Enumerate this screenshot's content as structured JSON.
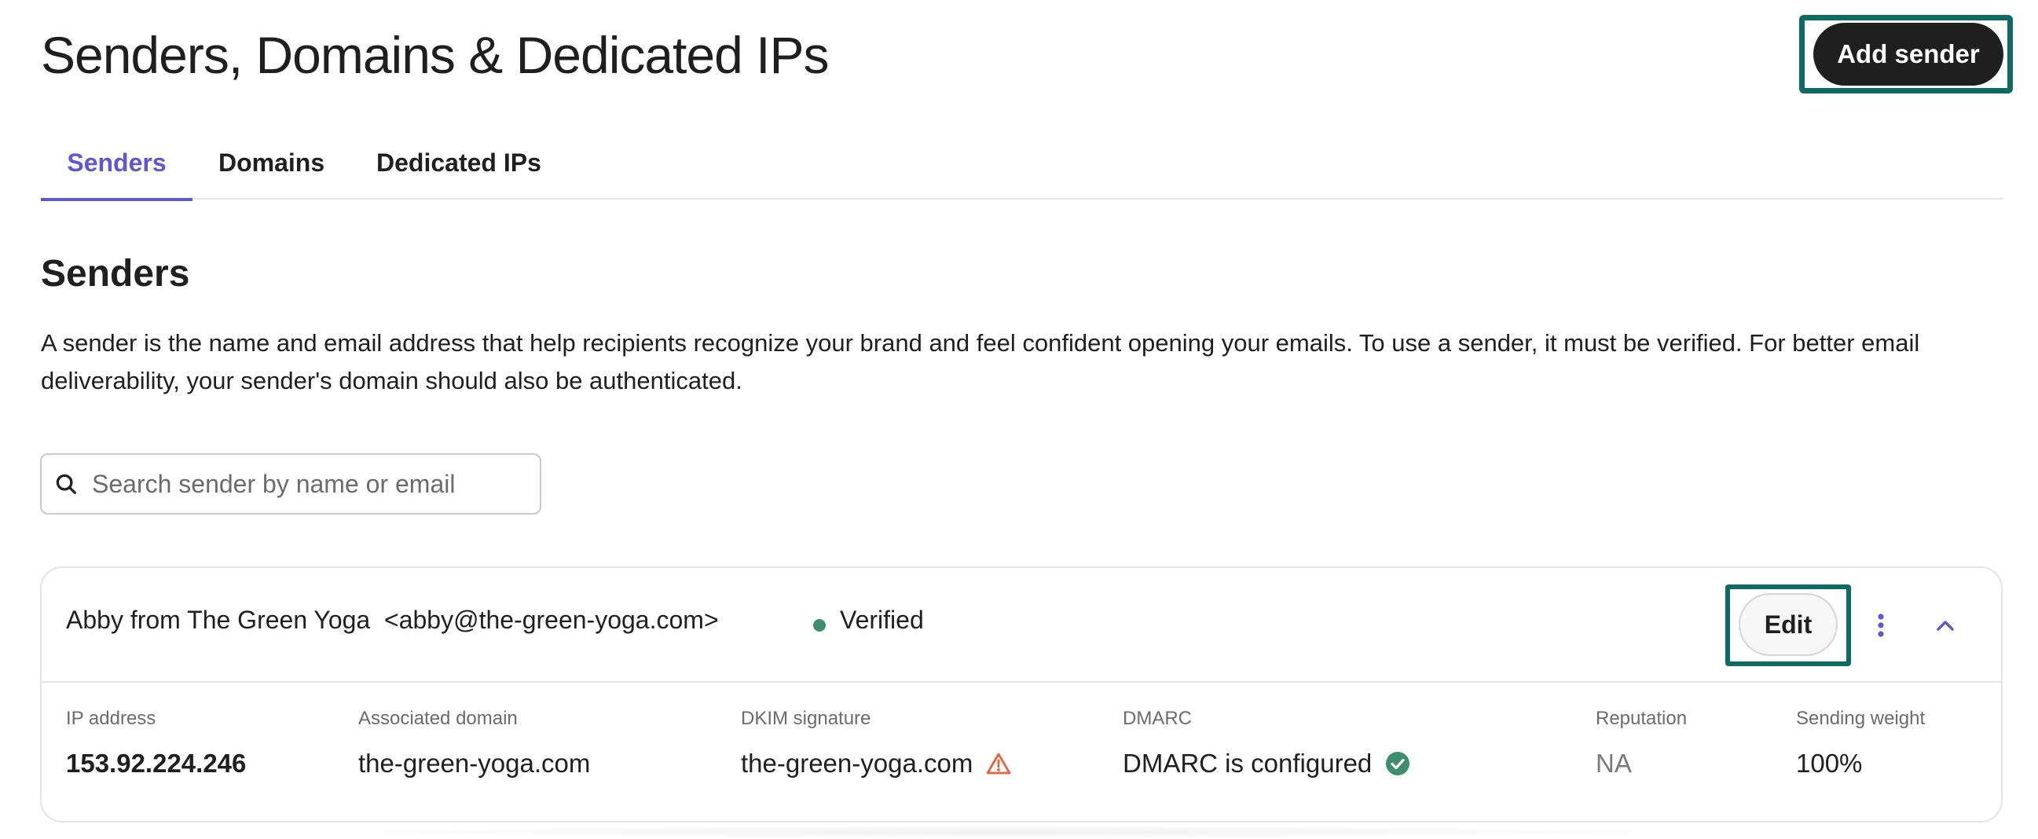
{
  "header": {
    "title": "Senders, Domains & Dedicated IPs",
    "add_sender_label": "Add sender"
  },
  "tabs": [
    {
      "label": "Senders",
      "active": true
    },
    {
      "label": "Domains",
      "active": false
    },
    {
      "label": "Dedicated IPs",
      "active": false
    }
  ],
  "section": {
    "title": "Senders",
    "description": "A sender is the name and email address that help recipients recognize your brand and feel confident opening your emails. To use a sender, it must be verified. For better email deliverability, your sender's domain should also be authenticated."
  },
  "search": {
    "placeholder": "Search sender by name or email",
    "value": ""
  },
  "sender": {
    "name": "Abby from The Green Yoga",
    "email": "<abby@the-green-yoga.com>",
    "status": "Verified",
    "edit_label": "Edit",
    "details": {
      "ip_label": "IP address",
      "ip_value": "153.92.224.246",
      "domain_label": "Associated domain",
      "domain_value": "the-green-yoga.com",
      "dkim_label": "DKIM signature",
      "dkim_value": "the-green-yoga.com",
      "dmarc_label": "DMARC",
      "dmarc_value": "DMARC is configured",
      "reputation_label": "Reputation",
      "reputation_value": "NA",
      "weight_label": "Sending weight",
      "weight_value": "100%"
    }
  },
  "icons": {
    "search": "search-icon",
    "status": "status-dot",
    "more": "more-vertical-icon",
    "collapse": "chevron-up-icon",
    "dkim_warning": "warning-icon",
    "dmarc_ok": "check-circle-icon"
  },
  "colors": {
    "accent": "#5f56d2",
    "highlight": "#0d6b63",
    "primary_button": "#1f1f1f",
    "verified": "#3d8f6b",
    "warning": "#e8643c"
  }
}
